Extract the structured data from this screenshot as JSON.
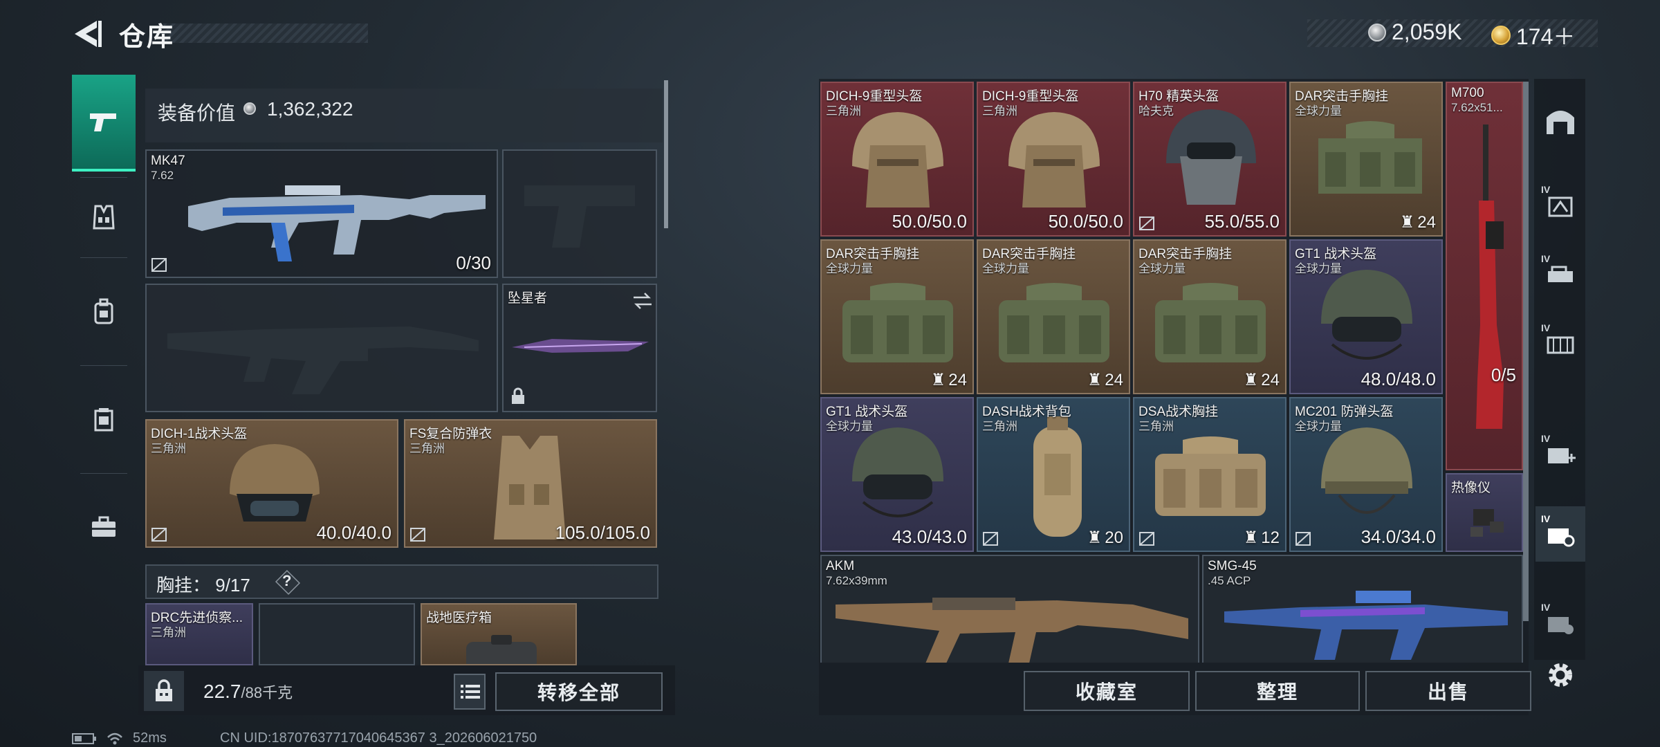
{
  "header": {
    "title": "仓库"
  },
  "currency": {
    "coins": "2,059K",
    "gold": "174＋"
  },
  "loadout": {
    "value_label": "装备价值",
    "value": "1,362,322",
    "primary": {
      "name": "MK47",
      "sub": "7.62",
      "ammo": "0/30"
    },
    "melee": {
      "name": "坠星者"
    },
    "helmet": {
      "name": "DICH-1战术头盔",
      "sub": "三角洲",
      "durability": "40.0/40.0"
    },
    "armor": {
      "name": "FS复合防弹衣",
      "sub": "三角洲",
      "durability": "105.0/105.0"
    },
    "chest": {
      "label": "胸挂：",
      "capacity": "9/17",
      "help": "?"
    },
    "chest_items": [
      {
        "name": "DRC先进侦察...",
        "sub": "三角洲"
      },
      {
        "name": "战地医疗箱",
        "sub": ""
      }
    ],
    "weight": "22.7",
    "weight_max": "/88千克",
    "transfer_all": "转移全部"
  },
  "stash": {
    "items": [
      {
        "name": "DICH-9重型头盔",
        "sub": "三角洲",
        "value": "50.0/50.0"
      },
      {
        "name": "DICH-9重型头盔",
        "sub": "三角洲",
        "value": "50.0/50.0"
      },
      {
        "name": "H70 精英头盔",
        "sub": "哈夫克",
        "value": "55.0/55.0"
      },
      {
        "name": "DAR突击手胸挂",
        "sub": "全球力量",
        "value": "24"
      },
      {
        "name": "M700",
        "sub": "7.62x51...",
        "value": "0/5"
      },
      {
        "name": "DAR突击手胸挂",
        "sub": "全球力量",
        "value": "24"
      },
      {
        "name": "DAR突击手胸挂",
        "sub": "全球力量",
        "value": "24"
      },
      {
        "name": "DAR突击手胸挂",
        "sub": "全球力量",
        "value": "24"
      },
      {
        "name": "GT1 战术头盔",
        "sub": "全球力量",
        "value": "48.0/48.0"
      },
      {
        "name": "GT1 战术头盔",
        "sub": "全球力量",
        "value": "43.0/43.0"
      },
      {
        "name": "DASH战术背包",
        "sub": "三角洲",
        "value": "20"
      },
      {
        "name": "DSA战术胸挂",
        "sub": "三角洲",
        "value": "12"
      },
      {
        "name": "MC201 防弹头盔",
        "sub": "全球力量",
        "value": "34.0/34.0"
      },
      {
        "name": "热像仪",
        "sub": "",
        "value": ""
      },
      {
        "name": "AKM",
        "sub": "7.62x39mm",
        "value": ""
      },
      {
        "name": "SMG-45",
        "sub": ".45 ACP",
        "value": ""
      }
    ],
    "actions": {
      "collection": "收藏室",
      "sort": "整理",
      "sell": "出售"
    }
  },
  "right_rail": {
    "tag": "IV"
  },
  "status": {
    "ping": "52ms",
    "uid": "CN UID:18707637717040645367 3_202606021750"
  },
  "colors": {
    "accent": "#19a386",
    "red_rarity": "#6f3038",
    "bronze_rarity": "#6b5640",
    "blue_rarity": "#2e4659",
    "purple_rarity": "#3f3e5c"
  },
  "icons": [
    "back-arrow-icon",
    "pistol-icon",
    "vest-icon",
    "backpack-icon",
    "pouch-icon",
    "briefcase-icon",
    "gear-icon",
    "lock-icon",
    "list-icon",
    "swap-icon",
    "no-insure-icon",
    "capacity-icon",
    "wifi-icon",
    "battery-icon"
  ]
}
